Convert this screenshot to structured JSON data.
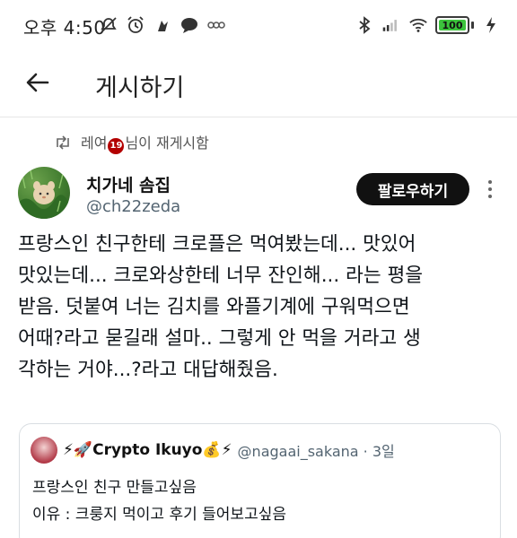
{
  "status_bar": {
    "time": "오후 4:50",
    "battery": {
      "level_percent": 100,
      "label": "100",
      "color": "#3cc43c"
    },
    "left_icons": [
      "mute-icon",
      "alarm-icon",
      "app-notification-icon",
      "chat-bubble-icon",
      "misc-notification-icon"
    ],
    "right_icons": [
      "bluetooth-icon",
      "cellular-signal-icon",
      "wifi-icon",
      "battery-icon",
      "charging-icon"
    ]
  },
  "header": {
    "title": "게시하기"
  },
  "repost": {
    "user": "레여",
    "badge": "19",
    "suffix": "님이 재게시함"
  },
  "post": {
    "display_name": "치가네 솜집",
    "username": "@ch22zeda",
    "follow_label": "팔로우하기",
    "body_lines": [
      "프랑스인 친구한테 크로플은 먹여봤는데... 맛있어",
      "맛있는데... 크로와상한테 너무 잔인해... 라는 평을",
      "받음. 덧붙여 너는 김치를 와플기계에 구워먹으면",
      "어때?라고 묻길래 설마.. 그렇게 안 먹을 거라고 생",
      "각하는 거야...?라고 대답해줬음."
    ]
  },
  "quote": {
    "display_name": "⚡🚀Crypto Ikuyo💰⚡",
    "handle_time": "@nagaai_sakana · 3일",
    "lines": [
      "프랑스인 친구 만들고싶음",
      "이유 : 크룽지 먹이고 후기 들어보고싶음"
    ]
  },
  "colors": {
    "accent_dark": "#111111",
    "muted_text": "#536471",
    "body_text": "#0f1419"
  }
}
